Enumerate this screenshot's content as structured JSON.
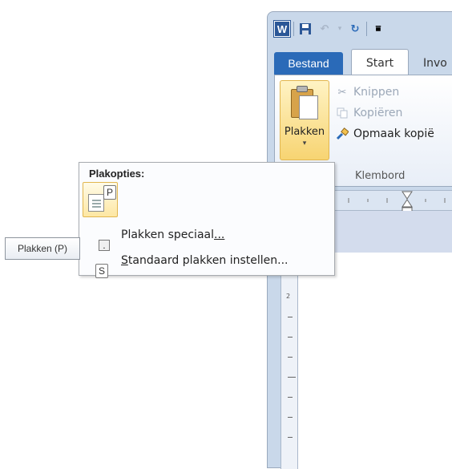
{
  "window": {
    "app_icon_letter": "W",
    "qat_icons": [
      "save-icon",
      "undo-icon",
      "redo-icon",
      "customize-qat-icon"
    ]
  },
  "tabs": {
    "file": "Bestand",
    "start": "Start",
    "insert_partial": "Invo"
  },
  "ribbon": {
    "paste_label": "Plakken",
    "paste_arrow": "▾",
    "cut": "Knippen",
    "copy": "Kopiëren",
    "format_painter": "Opmaak kopië",
    "group_label": "Klembord"
  },
  "paste_menu": {
    "heading": "Plakopties:",
    "option_keytip": "P",
    "items": [
      {
        "label_underlined": "Plakken speciaal",
        "mnemonic_after": "...",
        "keytip": "."
      },
      {
        "mnemonic_before": "S",
        "label_rest": "tandaard plakken instellen...",
        "keytip": "S"
      }
    ]
  },
  "tooltip": {
    "text": "Plakken (P)"
  },
  "ruler": {
    "vertical_label": "2"
  },
  "colors": {
    "file_tab": "#2a6ab8",
    "highlight": "#f7d472",
    "frame": "#c9d8ea"
  }
}
